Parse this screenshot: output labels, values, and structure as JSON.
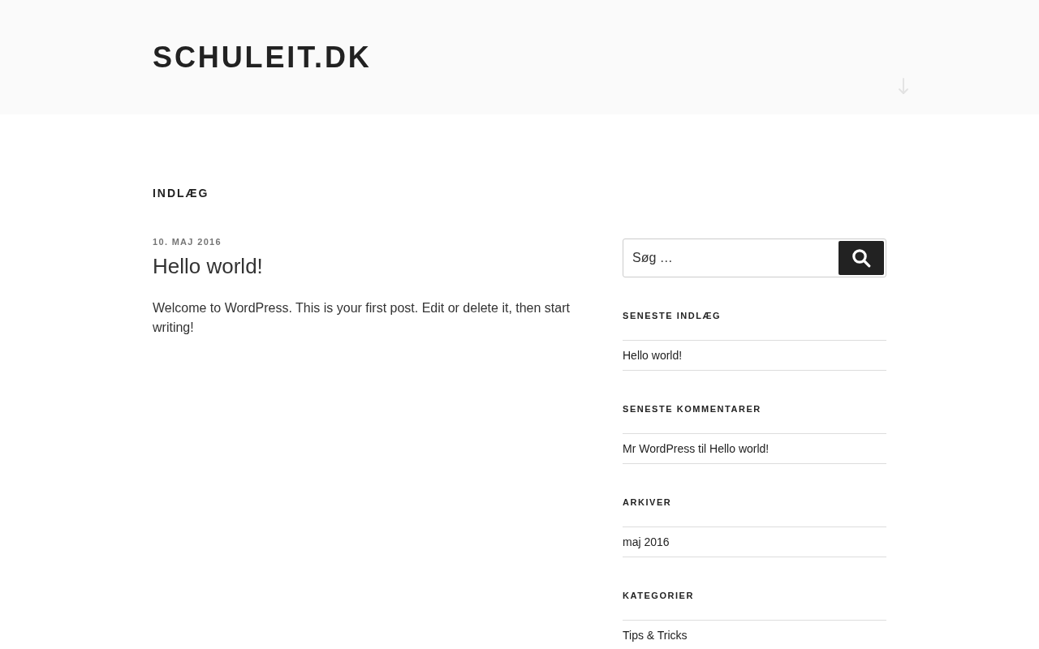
{
  "header": {
    "site_title": "SCHULEIT.DK"
  },
  "page_title": "INDLÆG",
  "posts": [
    {
      "date": "10. MAJ 2016",
      "title": "Hello world!",
      "excerpt": "Welcome to WordPress. This is your first post. Edit or delete it, then start writing!"
    }
  ],
  "sidebar": {
    "search": {
      "placeholder": "Søg …"
    },
    "widgets": [
      {
        "title": "SENESTE INDLÆG",
        "items": [
          "Hello world!"
        ]
      },
      {
        "title": "SENESTE KOMMENTARER",
        "items": [
          "Mr WordPress til Hello world!"
        ]
      },
      {
        "title": "ARKIVER",
        "items": [
          "maj 2016"
        ]
      },
      {
        "title": "KATEGORIER",
        "items": [
          "Tips & Tricks"
        ]
      }
    ]
  }
}
